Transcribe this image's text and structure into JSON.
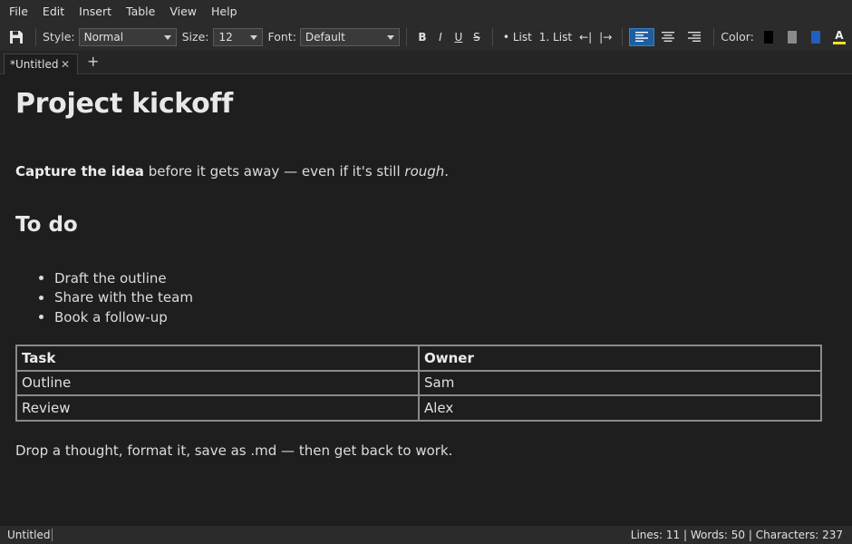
{
  "menu": [
    "File",
    "Edit",
    "Insert",
    "Table",
    "View",
    "Help"
  ],
  "toolbar": {
    "style_label": "Style:",
    "style_value": "Normal",
    "size_label": "Size:",
    "size_value": "12",
    "font_label": "Font:",
    "font_value": "Default",
    "bold": "B",
    "italic": "I",
    "underline": "U",
    "strike": "S",
    "bullet_list": "• List",
    "numbered_list": "1. List",
    "outdent": "←|",
    "indent": "|→",
    "color_label": "Color:",
    "colors": {
      "black": "#000000",
      "gray": "#8a8a8a",
      "blue": "#1f5fbf",
      "highlight": "#f5e21a"
    },
    "highlight_letter": "A"
  },
  "tabs": [
    {
      "title": "*Untitled",
      "close": "✕"
    }
  ],
  "tab_add": "+",
  "document": {
    "heading1": "Project kickoff",
    "para1": {
      "bold": "Capture the idea",
      "mid": " before it gets away — even if it's still ",
      "italic": "rough",
      "end": "."
    },
    "heading2": "To do",
    "bullets": [
      "Draft the outline",
      "Share with the team",
      "Book a follow-up"
    ],
    "table": {
      "headers": [
        "Task",
        "Owner"
      ],
      "rows": [
        [
          "Outline",
          "Sam"
        ],
        [
          "Review",
          "Alex"
        ]
      ]
    },
    "para2": "Drop a thought, format it, save as .md — then get back to work."
  },
  "status": {
    "filename": "Untitled",
    "stats": "Lines: 11  |  Words: 50  |  Characters: 237"
  }
}
